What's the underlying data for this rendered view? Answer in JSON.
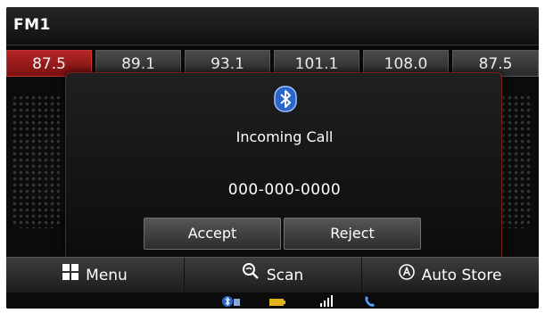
{
  "header": {
    "title": "FM1"
  },
  "presets": [
    {
      "label": "87.5",
      "active": true
    },
    {
      "label": "89.1"
    },
    {
      "label": "93.1"
    },
    {
      "label": "101.1"
    },
    {
      "label": "108.0"
    },
    {
      "label": "87.5"
    }
  ],
  "popup": {
    "icon": "bluetooth-icon",
    "title": "Incoming Call",
    "number": "000-000-0000",
    "accept_label": "Accept",
    "reject_label": "Reject"
  },
  "softkeys": {
    "menu_label": "Menu",
    "scan_label": "Scan",
    "auto_store_label": "Auto Store"
  },
  "status_icons": [
    "bluetooth-phone-icon",
    "battery-icon",
    "signal-icon",
    "call-icon"
  ],
  "colors": {
    "accent_red": "#b42626",
    "bluetooth_blue": "#2a66c9",
    "battery_yellow": "#e0b31a"
  }
}
